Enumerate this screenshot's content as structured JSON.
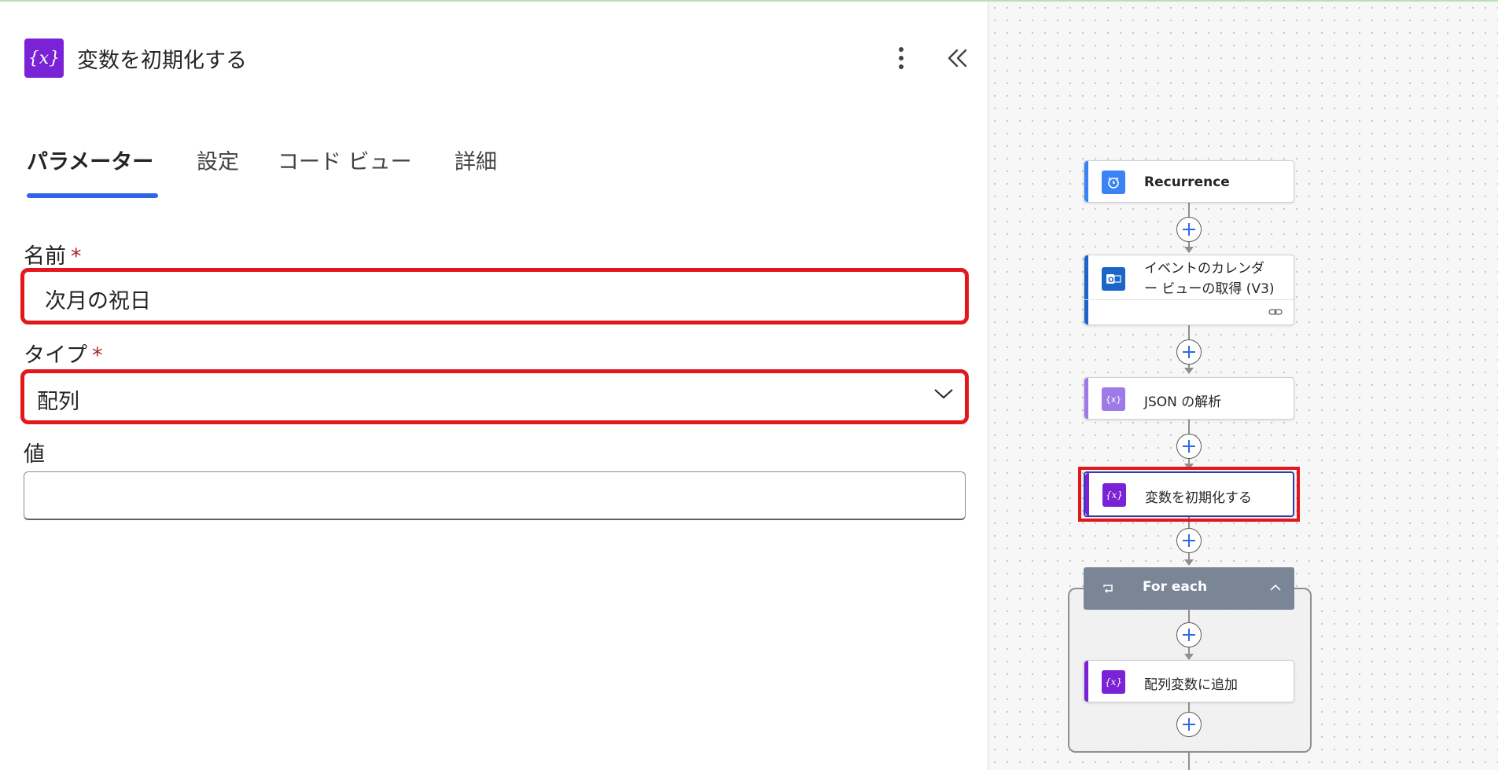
{
  "panel": {
    "title": "変数を初期化する",
    "header_icon": "{x}",
    "tabs": [
      {
        "label": "パラメーター",
        "active": true
      },
      {
        "label": "設定"
      },
      {
        "label": "コード ビュー"
      },
      {
        "label": "詳細"
      }
    ],
    "fields": {
      "name_label": "名前",
      "name_value": "次月の祝日",
      "type_label": "タイプ",
      "type_value": "配列",
      "value_label": "値",
      "value_value": "",
      "required_mark": "*"
    }
  },
  "flow": {
    "nodes": [
      {
        "label": "Recurrence",
        "icon": "clock-icon",
        "color": "#3b82f6"
      },
      {
        "label_line1": "イベントのカレンダ",
        "label_line2": "ー ビューの取得 (V3)",
        "icon": "outlook-icon",
        "color": "#1b65c9"
      },
      {
        "label": "JSON の解析",
        "icon": "data-operation-icon",
        "color": "#9d7ae8"
      },
      {
        "label": "変数を初期化する",
        "icon": "variable-icon",
        "color": "#7a22d6",
        "selected": true
      },
      {
        "label": "For each",
        "icon": "loop-icon",
        "color": "#7a8596"
      },
      {
        "label": "配列変数に追加",
        "icon": "variable-icon",
        "color": "#7a22d6"
      }
    ]
  },
  "colors": {
    "accent": "#2f67e8",
    "highlight": "#e3161b",
    "variable_purple": "#7a22d6"
  }
}
